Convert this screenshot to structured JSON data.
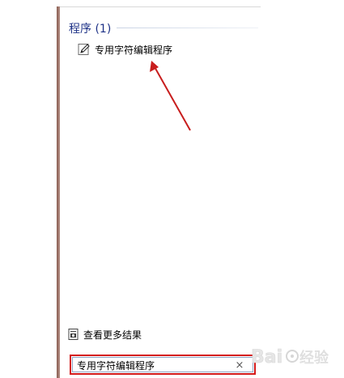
{
  "programs_section": {
    "heading": "程序 (1)",
    "items": [
      {
        "label": "专用字符编辑程序",
        "icon": "pencil-edit-icon"
      }
    ]
  },
  "see_more": {
    "label": "查看更多结果",
    "icon": "see-more-results-icon"
  },
  "search": {
    "value": "专用字符编辑程序",
    "clear_icon": "×"
  },
  "watermark": {
    "logo_text": "Baidu 经验"
  },
  "colors": {
    "heading": "#1e3287",
    "arrow": "#c81e1e",
    "search_highlight": "#d31a1a",
    "panel_edge": "#8a5e52"
  }
}
